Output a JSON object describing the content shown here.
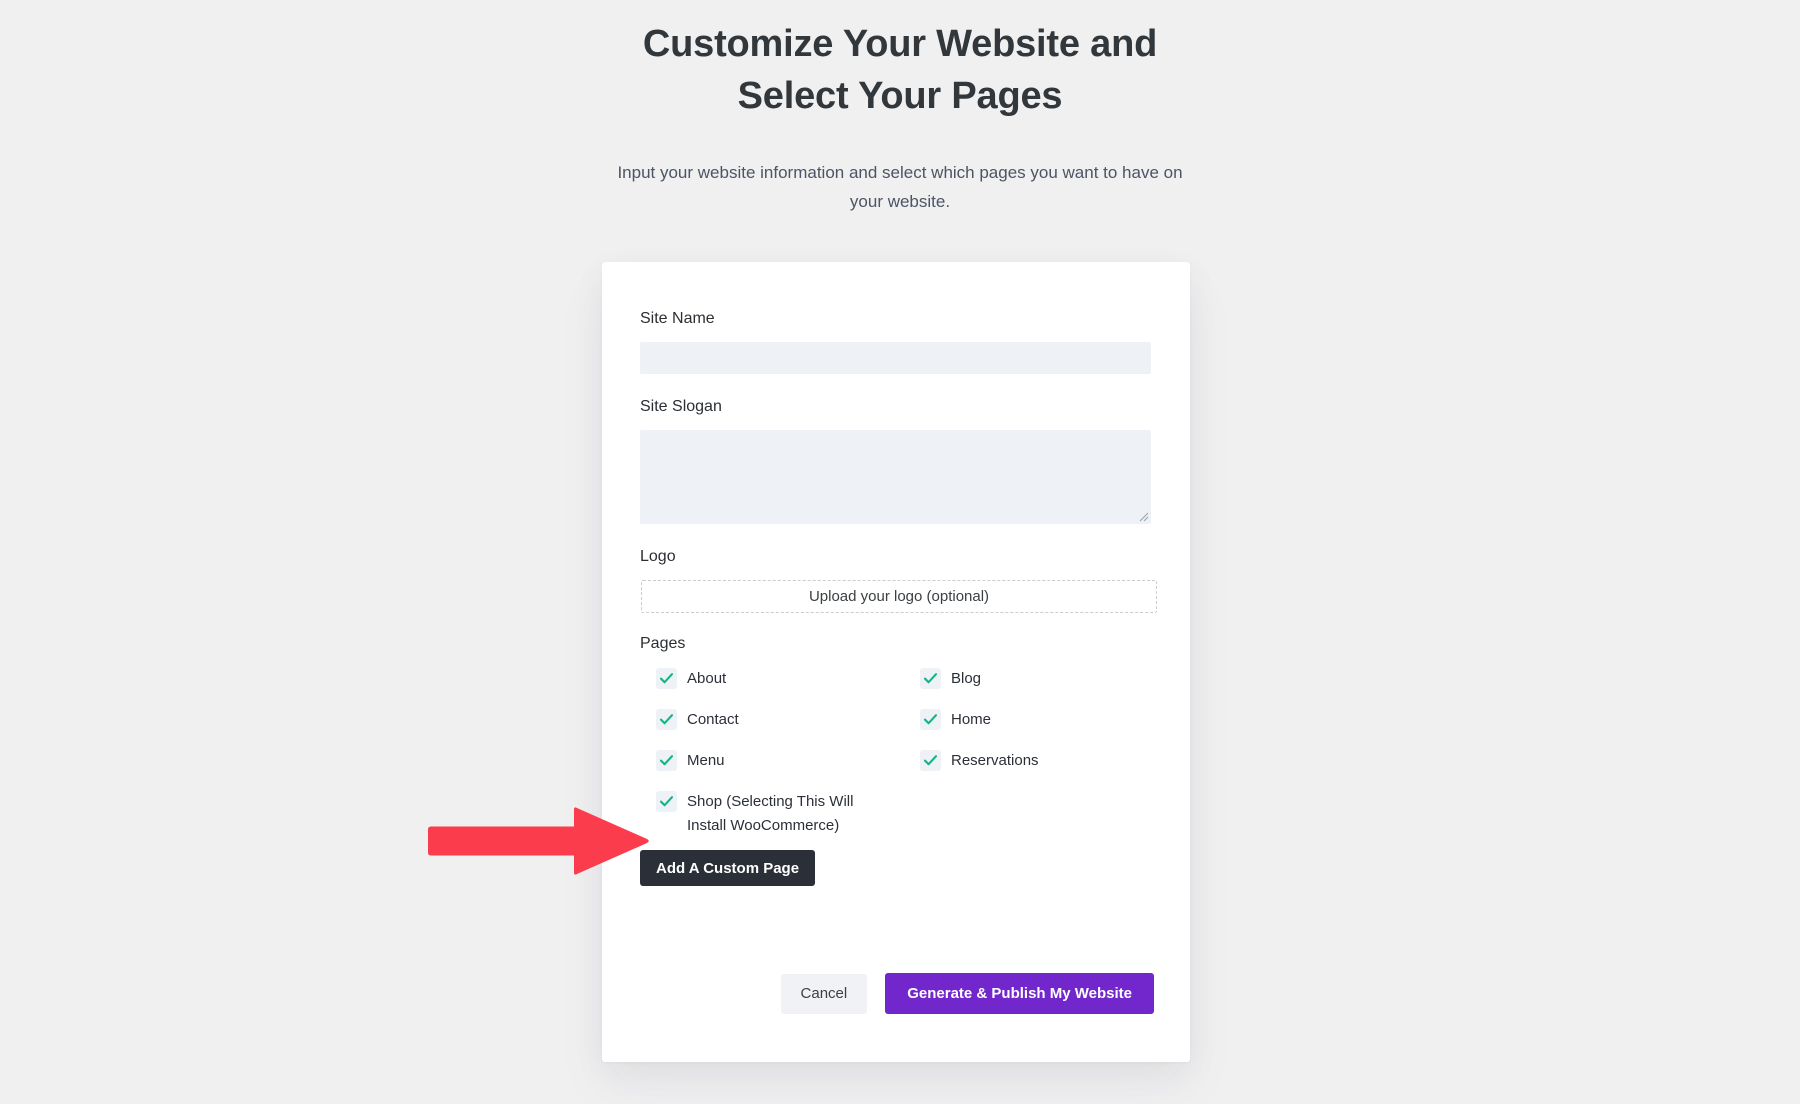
{
  "header": {
    "title": "Customize Your Website and Select Your Pages",
    "subtitle": "Input your website information and select which pages you want to have on your website."
  },
  "form": {
    "site_name": {
      "label": "Site Name",
      "value": "",
      "placeholder": ""
    },
    "site_slogan": {
      "label": "Site Slogan",
      "value": "",
      "placeholder": ""
    },
    "logo": {
      "label": "Logo",
      "upload_text": "Upload your logo (optional)"
    },
    "pages": {
      "label": "Pages",
      "items": [
        {
          "label": "About",
          "checked": true,
          "column": "left"
        },
        {
          "label": "Blog",
          "checked": true,
          "column": "right"
        },
        {
          "label": "Contact",
          "checked": true,
          "column": "left"
        },
        {
          "label": "Home",
          "checked": true,
          "column": "right"
        },
        {
          "label": "Menu",
          "checked": true,
          "column": "left"
        },
        {
          "label": "Reservations",
          "checked": true,
          "column": "right"
        },
        {
          "label": "Shop (Selecting This Will Install WooCommerce)",
          "checked": true,
          "column": "left"
        }
      ]
    },
    "add_custom_page_label": "Add A Custom Page"
  },
  "footer": {
    "cancel_label": "Cancel",
    "publish_label": "Generate & Publish My Website"
  },
  "annotation": {
    "type": "arrow",
    "points_to": "Shop (Selecting This Will Install WooCommerce)",
    "color": "#fa3c4c"
  },
  "colors": {
    "page_background": "#f0f0f1",
    "card_background": "#ffffff",
    "input_background": "#eef2f6",
    "checkbox_background": "#eef1f6",
    "checkmark": "#10b583",
    "primary_button": "#7227cc",
    "dark_button": "#2b3038",
    "cancel_button": "#f1f2f5",
    "heading_text": "#32373c",
    "body_text": "#4b5563",
    "arrow": "#fa3c4c"
  }
}
